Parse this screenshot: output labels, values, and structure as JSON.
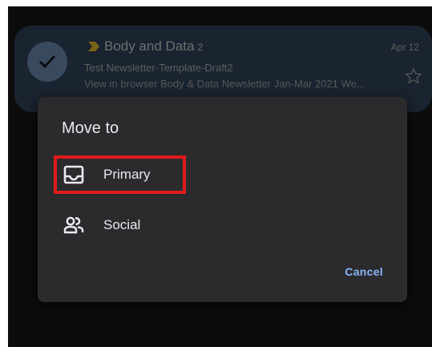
{
  "email": {
    "sender": "Body and Data",
    "thread_count": "2",
    "date": "Apr 12",
    "subject": "Test Newsletter-Template-Draft2",
    "snippet": "View in browser Body & Data Newsletter Jan-Mar 2021 We..."
  },
  "dialog": {
    "title": "Move to",
    "options": [
      {
        "label": "Primary",
        "icon": "inbox-icon"
      },
      {
        "label": "Social",
        "icon": "people-icon"
      }
    ],
    "cancel_label": "Cancel"
  },
  "colors": {
    "accent": "#8ab4f8",
    "highlight": "#e01b1b",
    "importance": "#c9a227"
  }
}
